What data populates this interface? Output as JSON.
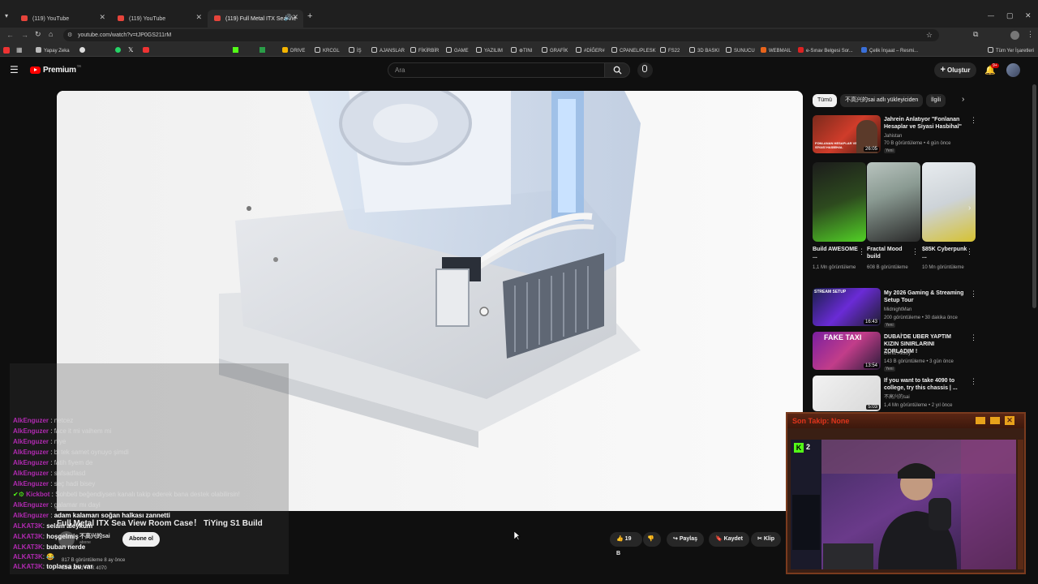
{
  "browser": {
    "tabs": [
      {
        "title": "(119) YouTube"
      },
      {
        "title": "(119) YouTube"
      },
      {
        "title": "(119) Full Metal ITX Sea Vie"
      }
    ],
    "url": "youtube.com/watch?v=tJP0GS211rM",
    "bookmarks": [
      "Yapay Zeka",
      "DRIVE",
      "KRCGL",
      "İŞ",
      "AJANSLAR",
      "FİKİRBİR",
      "GAME",
      "YAZILIM",
      "⊕TINI",
      "GRAFİK",
      "#DİĞER#",
      "CPANEL/PLESK",
      "FS22",
      "3D BASKI",
      "SUNUCU",
      "WEBMAIL",
      "e-Sınav Belgesi Sor...",
      "Çelik İnşaat – Resmi...",
      "Tüm Yer İşaretleri"
    ]
  },
  "youtube": {
    "logo": "Premium",
    "logo_sup": "TR",
    "search_placeholder": "Ara",
    "create_label": "Oluştur",
    "notif_count": "9+",
    "chips": [
      "Tümü",
      "不高兴的sai adlı yükleyiciden",
      "İlgili"
    ]
  },
  "video": {
    "title": "Full Metal ITX Sea View Room Case！ TiYing S1 Build",
    "channel": "不高兴的sai",
    "subs": "abone",
    "subscribe_label": "Abone ol",
    "likes": "19 B",
    "share_label": "Paylaş",
    "save_label": "Kaydet",
    "clip_label": "Klip",
    "views": "817 B görüntüleme  8 ay önce",
    "desc": "Strix 2251 RTX 4070"
  },
  "recommendations": [
    {
      "title": "Jahrein Anlatıyor \"Fonlanan Hesaplar ve Siyasi Hasbihal\"",
      "channel": "Jahistan",
      "meta": "70 B görüntüleme • 4 gün önce",
      "badge": "Yeni",
      "duration": "26:05",
      "thumb_text": "FONLANAN HESAPLAR VE SİYASİ HASBİHAL"
    },
    {
      "title": "My 2026 Gaming & Streaming Setup Tour",
      "channel": "MidnightMan",
      "meta": "200 görüntüleme • 30 dakika önce",
      "badge": "Yeni",
      "duration": "16:43",
      "thumb_text": "STREAM SETUP"
    },
    {
      "title": "DUBAİ'DE UBER YAPTIM KIZIN SINIRLARINI ZORLADIM !",
      "channel": "Deniz Aksoy",
      "meta": "143 B görüntüleme • 3 gün önce",
      "badge": "Yeni",
      "duration": "13:54",
      "thumb_text": "FAKE TAXI"
    },
    {
      "title": "If you want to take 4090 to college, try this chassis | ...",
      "channel": "不高兴的sai",
      "meta": "1,4 Mn görüntüleme • 2 yıl önce",
      "badge": "",
      "duration": "5:03",
      "thumb_text": ""
    }
  ],
  "shorts": [
    {
      "title": "Build AWESOME ...",
      "views": "1,1 Mn görüntüleme"
    },
    {
      "title": "Fractal Mood build",
      "views": "608 B görüntüleme"
    },
    {
      "title": "$85K Cyberpunk ...",
      "views": "10 Mn görüntüleme"
    }
  ],
  "chat": [
    {
      "user": "AlkEnguzer",
      "msg": "netcez",
      "faded": true
    },
    {
      "user": "AlkEnguzer",
      "msg": "face it mi vaihem mi",
      "faded": true
    },
    {
      "user": "AlkEnguzer",
      "msg": "niye",
      "faded": true
    },
    {
      "user": "AlkEnguzer",
      "msg": "bi tek samet oynuyo şimdi",
      "faded": true
    },
    {
      "user": "AlkEnguzer",
      "msg": "fatih fiyem de",
      "faded": true
    },
    {
      "user": "AlkEnguzer",
      "msg": "safsadfasd",
      "faded": true
    },
    {
      "user": "AlkEnguzer",
      "msg": "seç hadi bisey",
      "faded": true
    },
    {
      "user": "Kickbot",
      "msg": "Sohbeti beğendiysen kanalı takip ederek bana destek olabilirsin!",
      "faded": true
    },
    {
      "user": "AlkEnguzer",
      "msg": "galamar mı dayi",
      "faded": true
    },
    {
      "user": "AlkEnguzer",
      "msg": "adam kalamarı soğan halkası zannetti",
      "faded": false
    },
    {
      "user": "ALKAT3K",
      "msg": "selam aleykum",
      "faded": false
    },
    {
      "user": "ALKAT3K",
      "msg": "hoşgelmiş",
      "faded": false
    },
    {
      "user": "ALKAT3K",
      "msg": "buban nerde",
      "faded": false
    },
    {
      "user": "ALKAT3K",
      "msg": "😂",
      "faded": false
    },
    {
      "user": "ALKAT3K",
      "msg": "toplarsa bu var",
      "faded": false
    }
  ],
  "webcam": {
    "title": "Son Takip: None",
    "badge": "2"
  }
}
